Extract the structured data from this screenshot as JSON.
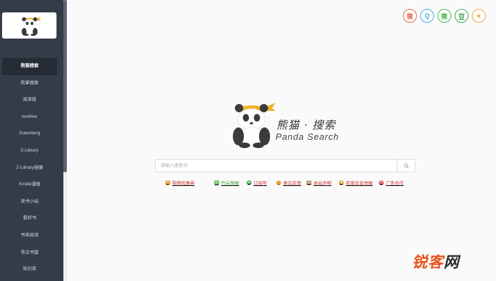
{
  "sidebar": {
    "items": [
      {
        "label": "熊猫搜索",
        "active": true
      },
      {
        "label": "熊掌搜索"
      },
      {
        "label": "阅读链"
      },
      {
        "label": "lorefree"
      },
      {
        "label": "Gutenberg"
      },
      {
        "label": "Z-Library"
      },
      {
        "label": "Z-Library镜像"
      },
      {
        "label": "Kindle漫画"
      },
      {
        "label": "读书小站"
      },
      {
        "label": "看好书"
      },
      {
        "label": "书单阅读"
      },
      {
        "label": "苦瓜书盘"
      },
      {
        "label": "知识库"
      }
    ]
  },
  "social": [
    {
      "name": "weibo",
      "glyph": "微"
    },
    {
      "name": "qq",
      "glyph": "Q"
    },
    {
      "name": "wechat",
      "glyph": "微"
    },
    {
      "name": "douban",
      "glyph": "豆"
    },
    {
      "name": "favorite",
      "glyph": "★"
    }
  ],
  "brand": {
    "title_cn": "熊猫 · 搜索",
    "title_en": "Panda Search"
  },
  "search": {
    "placeholder": "请输入搜索词",
    "value": ""
  },
  "links": [
    {
      "label": "购物优惠券",
      "color": "#d0312d",
      "icon_color": "#e6a23c",
      "icon": "coupon-icon"
    },
    {
      "label": "竹尖快搜",
      "color": "#3a9a3a",
      "icon_color": "#5cb85c",
      "icon": "bamboo-icon"
    },
    {
      "label": "订阅号",
      "color": "#d0312d",
      "icon_color": "#44b549",
      "icon": "wechat-icon"
    },
    {
      "label": "意见反馈",
      "color": "#d0312d",
      "icon_color": "#e6a23c",
      "icon": "feedback-icon"
    },
    {
      "label": "本站声明",
      "color": "#d0312d",
      "icon_color": "#b08a5a",
      "icon": "statement-icon"
    },
    {
      "label": "有害信息举报",
      "color": "#d0312d",
      "icon_color": "#e6a23c",
      "icon": "warning-icon"
    },
    {
      "label": "广告合作",
      "color": "#d0312d",
      "icon_color": "#d9534f",
      "icon": "ad-icon"
    }
  ],
  "watermark": {
    "text_main": "锐客",
    "text_last": "网"
  }
}
